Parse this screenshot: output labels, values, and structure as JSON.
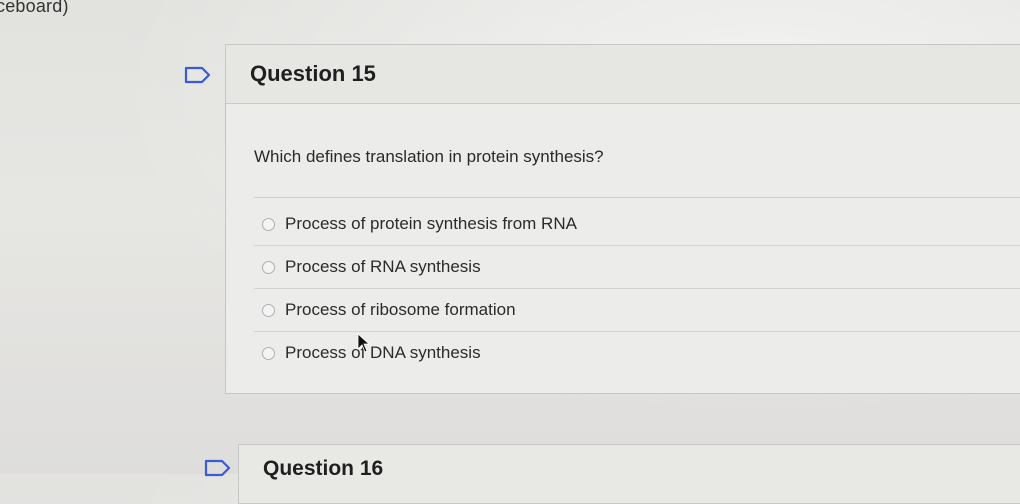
{
  "breadcrumb": {
    "text": "ceboard)"
  },
  "question": {
    "title": "Question 15",
    "text": "Which defines translation in protein synthesis?",
    "answers": [
      {
        "label": "Process of protein synthesis from RNA"
      },
      {
        "label": "Process of RNA synthesis"
      },
      {
        "label": "Process of ribosome formation"
      },
      {
        "label": "Process of DNA synthesis"
      }
    ]
  },
  "next_question": {
    "title": "Question 16"
  },
  "icons": {
    "flag": "bookmark-flag-icon",
    "cursor": "mouse-pointer-icon"
  },
  "colors": {
    "background": "#e4e4e1",
    "card": "#ececea",
    "flag_stroke": "#3b5bd6"
  }
}
